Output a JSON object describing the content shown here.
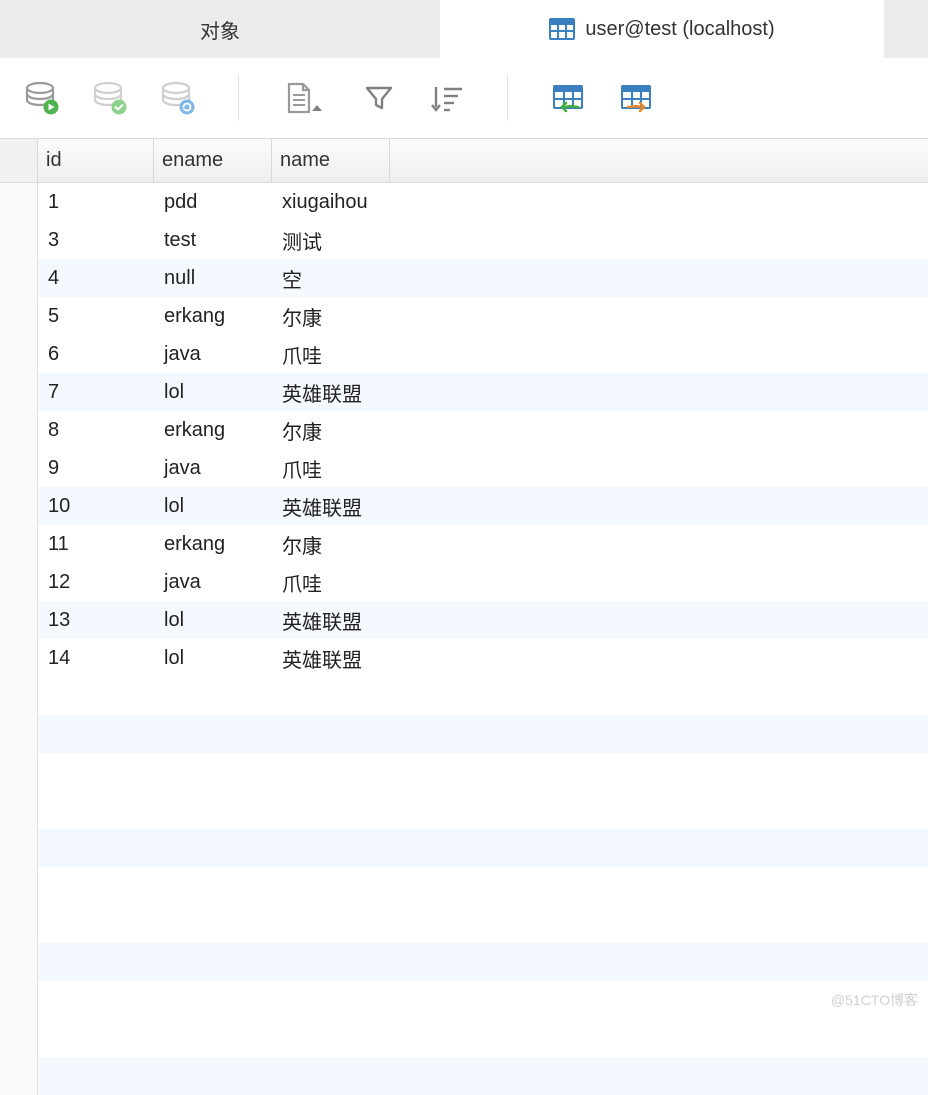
{
  "tabs": {
    "inactive": "对象",
    "active": "user@test (localhost)"
  },
  "toolbar": {
    "run": "run-query",
    "commit": "commit",
    "refresh": "refresh",
    "doc": "document",
    "filter": "filter",
    "sort": "sort",
    "import": "import",
    "export": "export"
  },
  "columns": {
    "id": "id",
    "ename": "ename",
    "name": "name"
  },
  "rows": [
    {
      "id": "1",
      "ename": "pdd",
      "name": "xiugaihou"
    },
    {
      "id": "3",
      "ename": "test",
      "name": "测试"
    },
    {
      "id": "4",
      "ename": "null",
      "name": "空"
    },
    {
      "id": "5",
      "ename": "erkang",
      "name": "尔康"
    },
    {
      "id": "6",
      "ename": "java",
      "name": "爪哇"
    },
    {
      "id": "7",
      "ename": "lol",
      "name": "英雄联盟"
    },
    {
      "id": "8",
      "ename": "erkang",
      "name": "尔康"
    },
    {
      "id": "9",
      "ename": "java",
      "name": "爪哇"
    },
    {
      "id": "10",
      "ename": "lol",
      "name": "英雄联盟"
    },
    {
      "id": "11",
      "ename": "erkang",
      "name": "尔康"
    },
    {
      "id": "12",
      "ename": "java",
      "name": "爪哇"
    },
    {
      "id": "13",
      "ename": "lol",
      "name": "英雄联盟"
    },
    {
      "id": "14",
      "ename": "lol",
      "name": "英雄联盟"
    }
  ],
  "stripe_indexes": [
    2,
    5,
    8,
    11
  ],
  "empty_stripe_indexes": [
    1,
    4,
    7,
    10
  ],
  "empty_row_count": 11,
  "watermark": "@51CTO博客"
}
